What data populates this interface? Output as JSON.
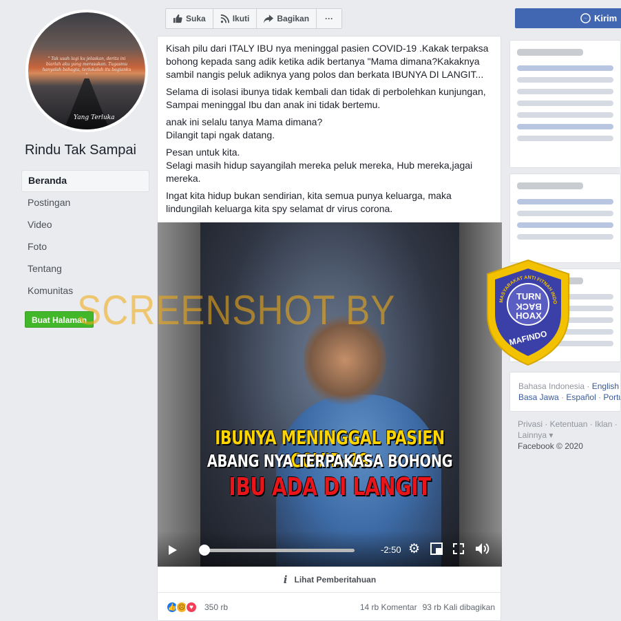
{
  "page": {
    "name": "Rindu Tak Sampai",
    "avatar_quote": "\" Tak usah lagi ku jelaskan, derita ini biarlah aku yang merasakan. Tugasmu hanyalah bahagia, terlukalah itu bagianku \"",
    "avatar_signature": "Yang Terluka"
  },
  "sidebar": {
    "items": [
      {
        "label": "Beranda",
        "active": true
      },
      {
        "label": "Postingan",
        "active": false
      },
      {
        "label": "Video",
        "active": false
      },
      {
        "label": "Foto",
        "active": false
      },
      {
        "label": "Tentang",
        "active": false
      },
      {
        "label": "Komunitas",
        "active": false
      }
    ],
    "create_page_label": "Buat Halaman"
  },
  "actionbar": {
    "like_label": "Suka",
    "follow_label": "Ikuti",
    "share_label": "Bagikan",
    "more_label": "···",
    "send_label": "Kirim"
  },
  "post": {
    "paragraphs": [
      "Kisah pilu dari ITALY IBU nya meninggal pasien COVID-19 .Kakak terpaksa bohong kepada sang adik ketika adik bertanya \"Mama dimana?Kakaknya sambil nangis peluk adiknya yang polos dan berkata IBUNYA DI LANGIT...",
      "Selama di isolasi ibunya tidak kembali dan tidak di perbolehkan kunjungan, Sampai meninggal Ibu dan anak ini tidak bertemu.",
      "anak ini selalu tanya Mama dimana?\nDilangit tapi ngak datang.",
      "Pesan untuk kita.\nSelagi masih hidup sayangilah mereka peluk mereka, Hub mereka,jagai mereka.",
      "Ingat kita hidup bukan sendirian, kita semua punya keluarga, maka lindungilah keluarga kita spy selamat dr virus corona."
    ],
    "video": {
      "caption_1": "IBUNYA MENINGGAL PASIEN COVID-19",
      "caption_2": "ABANG NYA TERPAKASA BOHONG",
      "caption_3": "IBU ADA DI LANGIT",
      "time_remaining": "-2:50",
      "progress": 0.0
    },
    "notice_label": "Lihat Pemberitahuan",
    "reaction_count": "350 rb",
    "comments": "14 rb Komentar",
    "shares": "93 rb Kali dibagikan"
  },
  "right_rail": {
    "languages": [
      "Bahasa Indonesia",
      "English",
      "Basa Jawa",
      "Español",
      "Portu"
    ],
    "footer_links": "Privasi · Ketentuan · Iklan · ",
    "footer_more": "Lainnya ▾",
    "copyright": "Facebook © 2020"
  },
  "watermark": {
    "text": "SCREENSHOT BY",
    "badge_line1": "TURN",
    "badge_line2": "BACK",
    "badge_line3": "HOAX",
    "badge_bottom": "MAFINDO",
    "badge_ring": "MASYARAKAT ANTI FITNAH INDONESIA"
  },
  "colors": {
    "facebook_blue": "#4267b2",
    "green_button": "#42b72a",
    "watermark_orange": "#f1aa14",
    "badge_blue": "#3b3fa8",
    "badge_gold": "#f2c200"
  }
}
